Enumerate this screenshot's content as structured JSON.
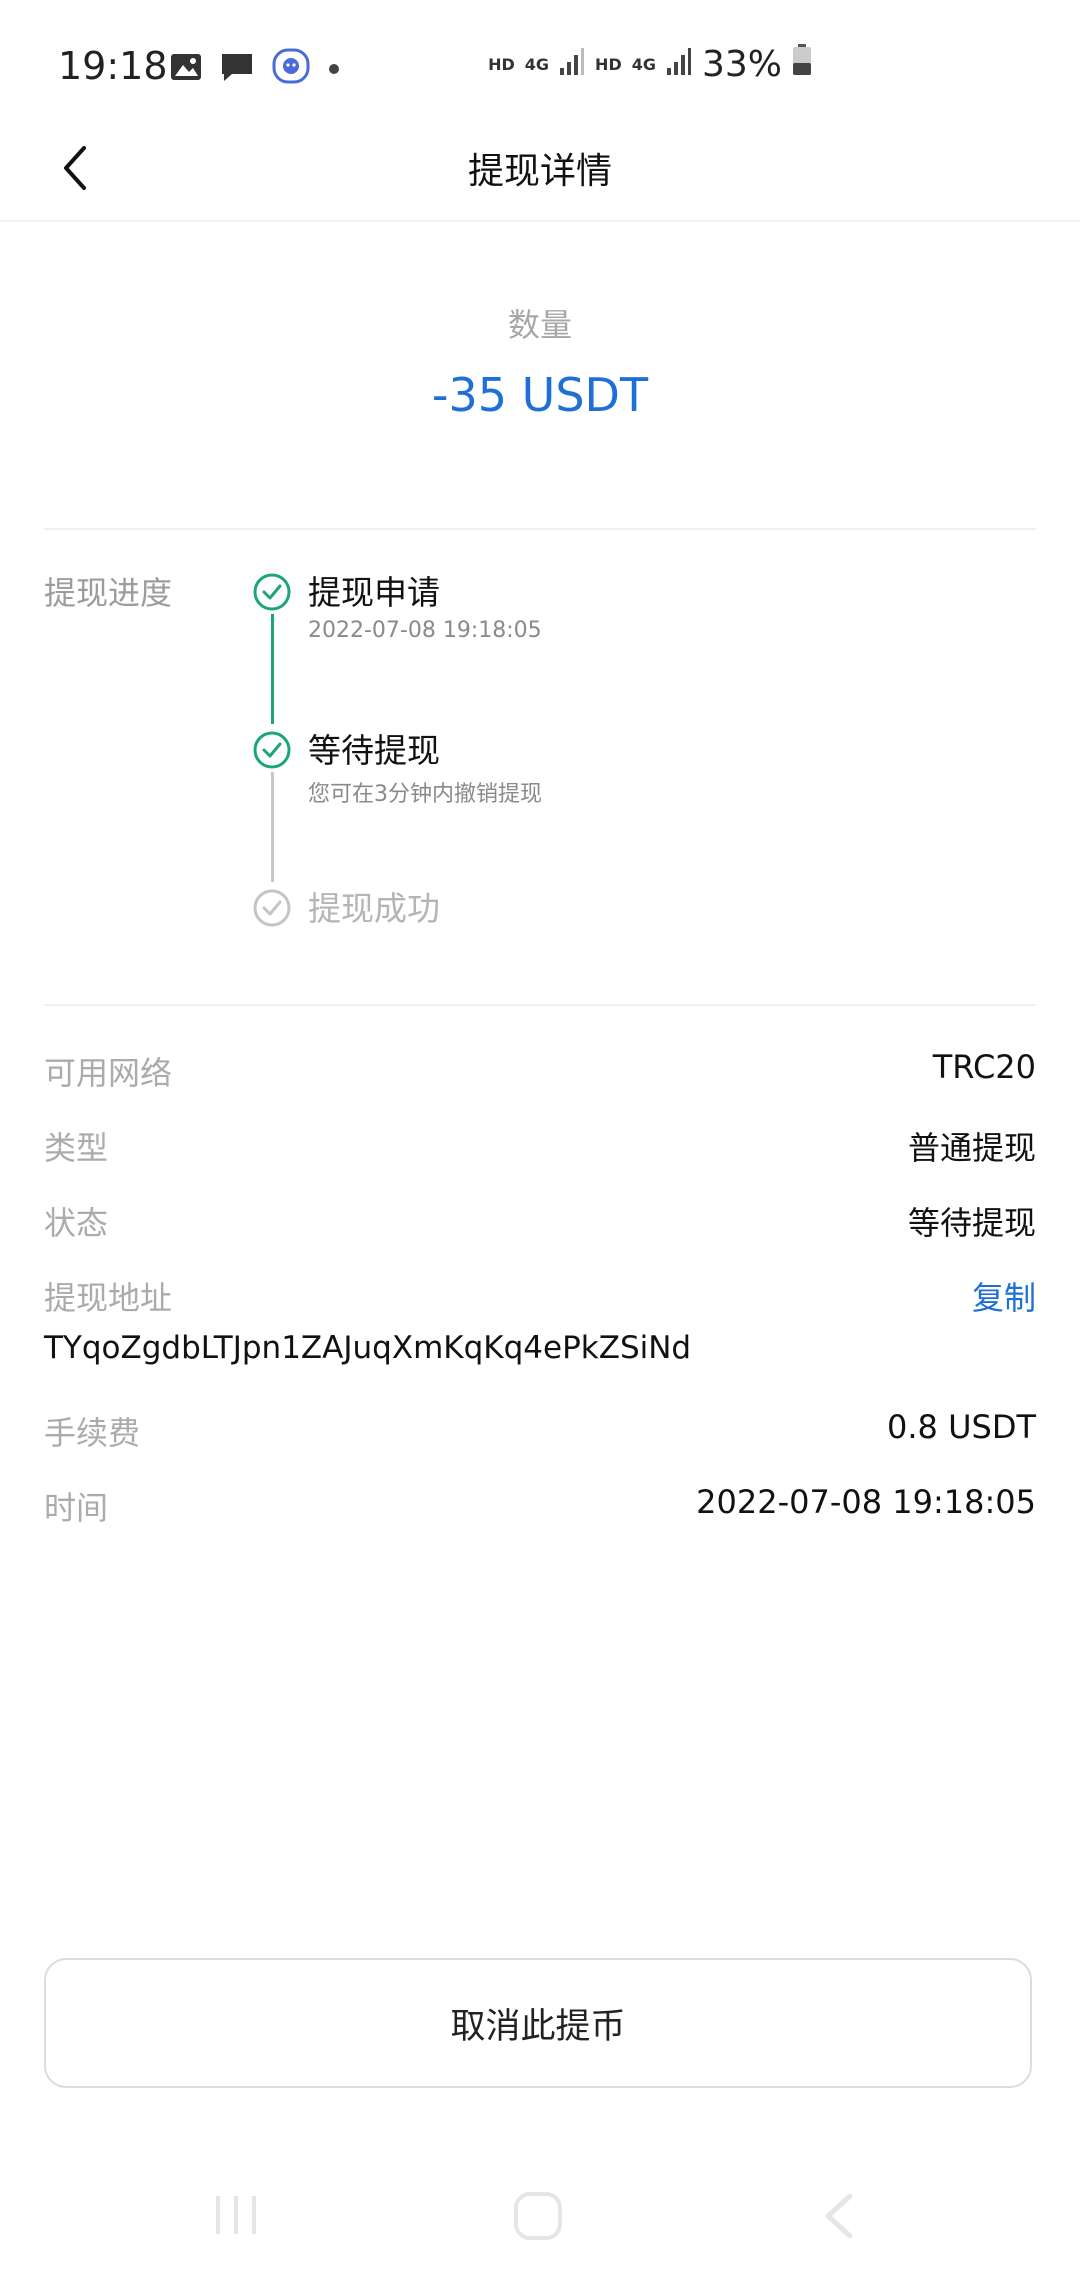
{
  "status_bar": {
    "time": "19:18",
    "hd1": "HD",
    "net1": "4G",
    "hd2": "HD",
    "net2": "4G",
    "battery": "33%",
    "icons": [
      "gallery-icon",
      "message-icon",
      "cat-chat-icon",
      "dot-icon",
      "signal-icon",
      "battery-icon"
    ]
  },
  "header": {
    "title": "提现详情",
    "back_icon": "chevron-left-icon"
  },
  "amount": {
    "label": "数量",
    "value": "-35 USDT"
  },
  "progress": {
    "label": "提现进度",
    "steps": [
      {
        "title": "提现申请",
        "subtitle": "2022-07-08 19:18:05",
        "status": "done"
      },
      {
        "title": "等待提现",
        "subtitle": "您可在3分钟内撤销提现",
        "status": "done"
      },
      {
        "title": "提现成功",
        "subtitle": "",
        "status": "pending"
      }
    ]
  },
  "details": {
    "network_label": "可用网络",
    "network_value": "TRC20",
    "type_label": "类型",
    "type_value": "普通提现",
    "status_label": "状态",
    "status_value": "等待提现",
    "address_label": "提现地址",
    "copy_label": "复制",
    "address_value": "TYqoZgdbLTJpn1ZAJuqXmKqKq4ePkZSiNd",
    "fee_label": "手续费",
    "fee_value": "0.8 USDT",
    "time_label": "时间",
    "time_value": "2022-07-08 19:18:05"
  },
  "cancel_button": "取消此提币",
  "colors": {
    "accent_blue": "#1f6fd8",
    "step_green": "#1aa57a",
    "step_gray": "#c4c4c4",
    "label_gray": "#ababab"
  }
}
